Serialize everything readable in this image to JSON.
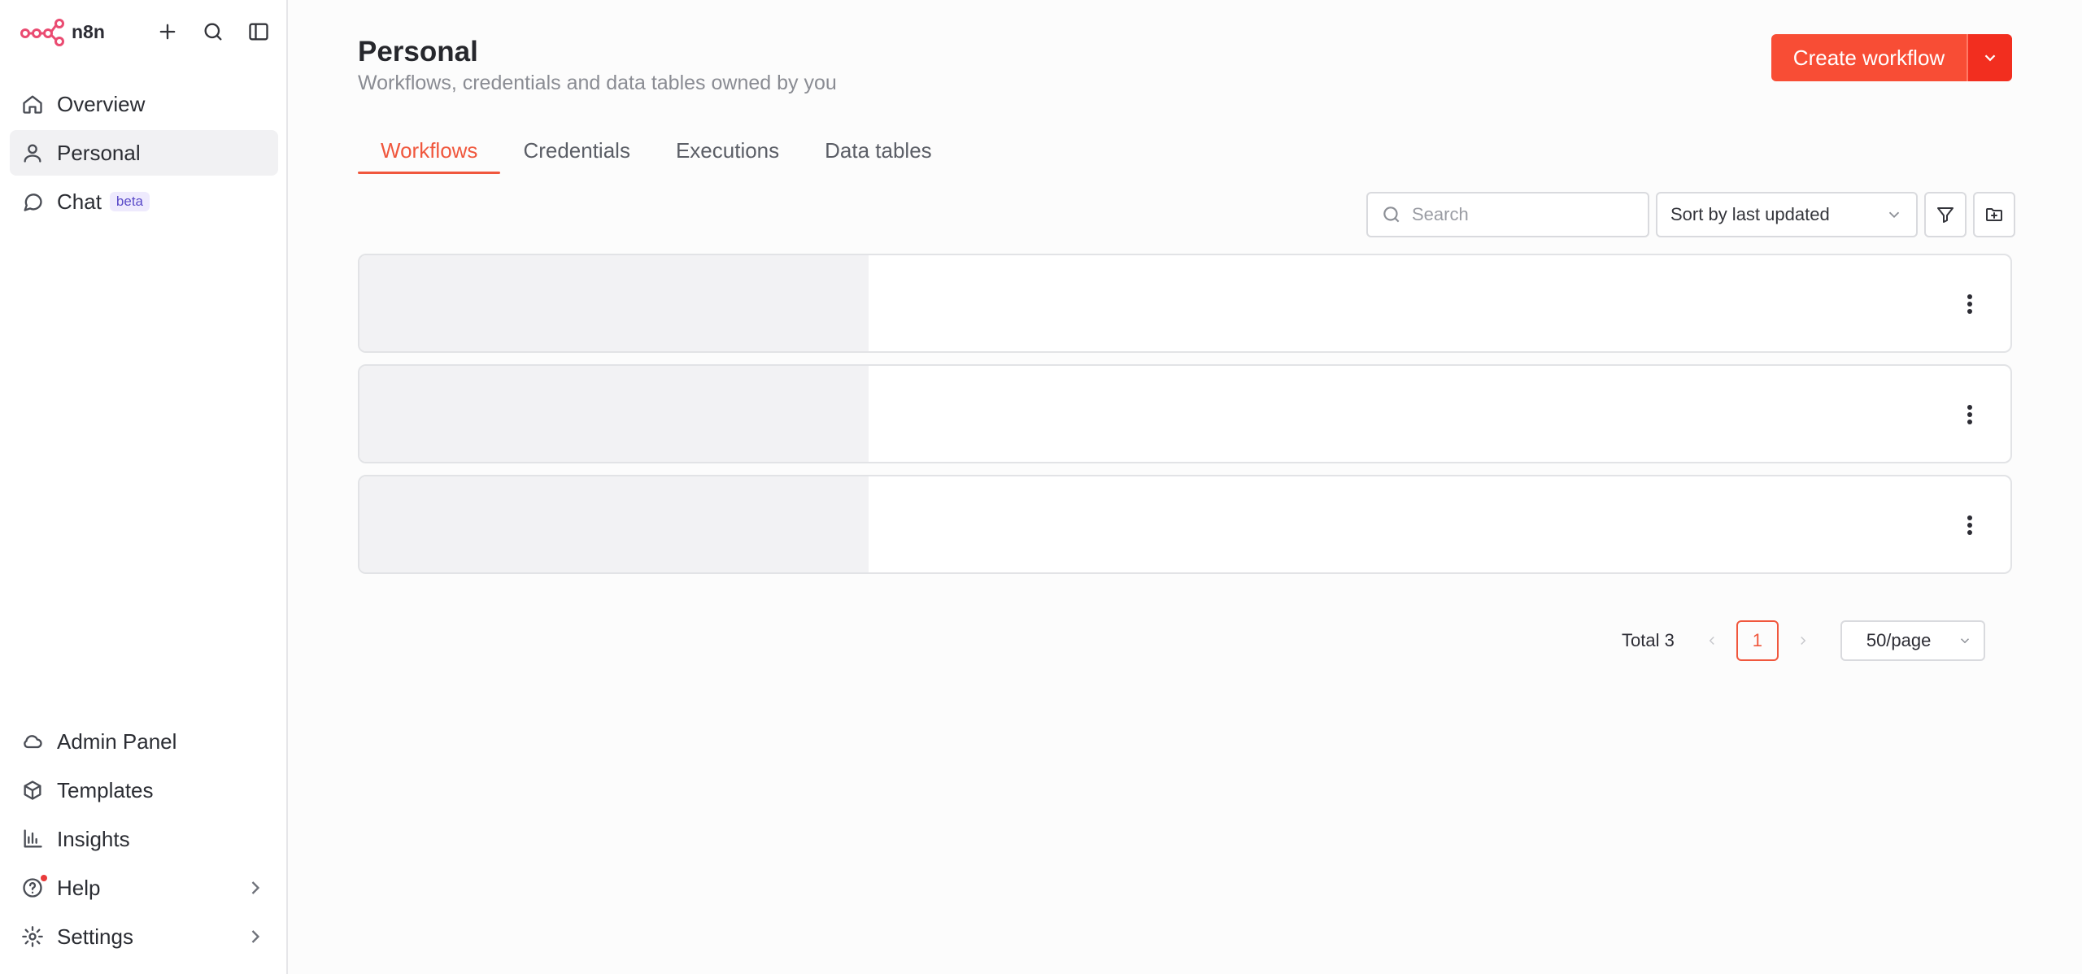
{
  "brand": {
    "name": "n8n",
    "accent": "#ea4b71"
  },
  "sidebar": {
    "top_items": [
      {
        "label": "Overview",
        "icon": "home-icon"
      },
      {
        "label": "Personal",
        "icon": "user-icon",
        "active": true
      },
      {
        "label": "Chat",
        "icon": "chat-icon",
        "badge": "beta"
      }
    ],
    "bottom_items": [
      {
        "label": "Admin Panel",
        "icon": "cloud-icon"
      },
      {
        "label": "Templates",
        "icon": "box-icon"
      },
      {
        "label": "Insights",
        "icon": "bar-chart-icon"
      },
      {
        "label": "Help",
        "icon": "help-icon"
      },
      {
        "label": "Settings",
        "icon": "gear-icon"
      }
    ]
  },
  "header": {
    "title": "Personal",
    "subtitle": "Workflows, credentials and data tables owned by you",
    "create_label": "Create workflow",
    "create_color": "#f84d35"
  },
  "tabs": [
    {
      "label": "Workflows",
      "active": true
    },
    {
      "label": "Credentials"
    },
    {
      "label": "Executions"
    },
    {
      "label": "Data tables"
    }
  ],
  "toolbar": {
    "search_placeholder": "Search",
    "sort_value": "Sort by last updated"
  },
  "pagination": {
    "total": "Total 3",
    "current_page": "1",
    "per_page": "50/page"
  }
}
